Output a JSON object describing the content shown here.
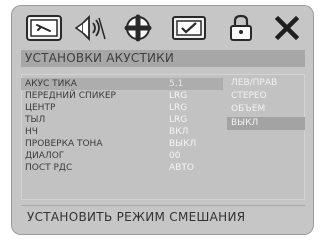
{
  "toolbar": {
    "icons": [
      "general-setup-icon",
      "audio-setup-icon",
      "video-setup-icon",
      "preference-icon",
      "password-lock-icon",
      "exit-icon"
    ]
  },
  "title": "УСТАНОВКИ АКУСТИКИ",
  "settings": [
    {
      "label": "АКУС ТИКА",
      "value": "5.1"
    },
    {
      "label": "ПЕРЕДНИЙ СПИКЕР",
      "value": "LRG"
    },
    {
      "label": "ЦЕНТР",
      "value": "LRG"
    },
    {
      "label": "ТЫЛ",
      "value": "LRG"
    },
    {
      "label": "НЧ",
      "value": "ВКЛ"
    },
    {
      "label": "ПРОВЕРКА ТОНА",
      "value": "ВЫКЛ"
    },
    {
      "label": "ДИАЛОГ",
      "value": "00"
    },
    {
      "label": "ПОСТ РДС",
      "value": "АВТО"
    }
  ],
  "options": [
    "ЛЕВ/ПРАВ",
    "СТЕРЕО",
    "ОБЪЕМ",
    "ВЫКЛ"
  ],
  "selected_option": "ВЫКЛ",
  "footer_text": "УСТАНОВИТЬ РЕЖИМ СМЕШАНИЯ"
}
